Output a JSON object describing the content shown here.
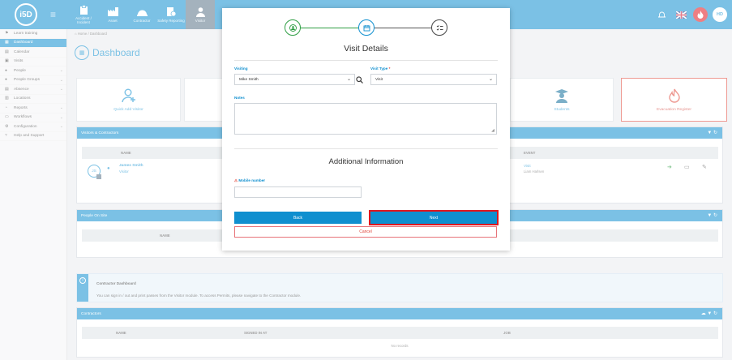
{
  "app": {
    "logo_text": "i5D",
    "nav": [
      {
        "label": "Accident / Incident",
        "icon": "clipboard-icon"
      },
      {
        "label": "Asset",
        "icon": "factory-icon"
      },
      {
        "label": "Contractor",
        "icon": "hardhat-icon"
      },
      {
        "label": "Safety Reporting",
        "icon": "report-icon"
      },
      {
        "label": "Visitor",
        "icon": "visitor-icon"
      }
    ],
    "user_initials": "HD"
  },
  "sidebar": {
    "items": [
      {
        "label": "Learn training",
        "icon": "graduation-icon"
      },
      {
        "label": "Dashboard",
        "icon": "dashboard-icon"
      },
      {
        "label": "Calendar",
        "icon": "calendar-icon"
      },
      {
        "label": "Visits",
        "icon": "visits-icon"
      },
      {
        "label": "People",
        "icon": "people-icon"
      },
      {
        "label": "People Groups",
        "icon": "group-icon"
      },
      {
        "label": "Absence",
        "icon": "absence-icon"
      },
      {
        "label": "Locations",
        "icon": "location-icon"
      },
      {
        "label": "Reports",
        "icon": "reports-icon"
      },
      {
        "label": "Workflows",
        "icon": "workflow-icon"
      },
      {
        "label": "Configuration",
        "icon": "config-icon"
      },
      {
        "label": "Help and Support",
        "icon": "help-icon"
      }
    ]
  },
  "breadcrumb": {
    "home": "Home",
    "current": "Dashboard"
  },
  "dashboard": {
    "title": "Dashboard",
    "cards": {
      "quick_add": "Quick Add Visitor",
      "students": "Students",
      "evacuation": "Evacuation Register"
    },
    "visitors_panel": {
      "title": "Visitors & Contractors",
      "col_name": "NAME",
      "col_event": "EVENT",
      "row": {
        "initials": "JS",
        "name": "James Smith",
        "role": "Visitor",
        "event": "Visit",
        "event_host": "Liam Harlsen"
      }
    },
    "people_panel": {
      "title": "People On Site",
      "col_name": "NAME"
    },
    "info": {
      "title": "Contractor Dashboard",
      "text": "You can sign in / out and print passes from the Visitor module. To access Permits, please navigate to the Contractor module."
    },
    "contractors_panel": {
      "title": "Contractors",
      "col_name": "NAME",
      "col_signed": "SIGNED IN AT",
      "col_job": "JOB",
      "empty": "No records"
    }
  },
  "modal": {
    "title": "Visit Details",
    "visiting_label": "Visiting",
    "visiting_value": "Mike Smith",
    "visit_type_label": "Visit Type",
    "visit_type_required": "*",
    "visit_type_value": "Visit",
    "notes_label": "Notes",
    "additional_title": "Additional Information",
    "mobile_label": "Mobile number",
    "back_label": "Back",
    "next_label": "Next",
    "cancel_label": "Cancel"
  },
  "colors": {
    "brand": "#0f8fcf",
    "danger": "#e0161e",
    "success": "#2f9e44"
  }
}
